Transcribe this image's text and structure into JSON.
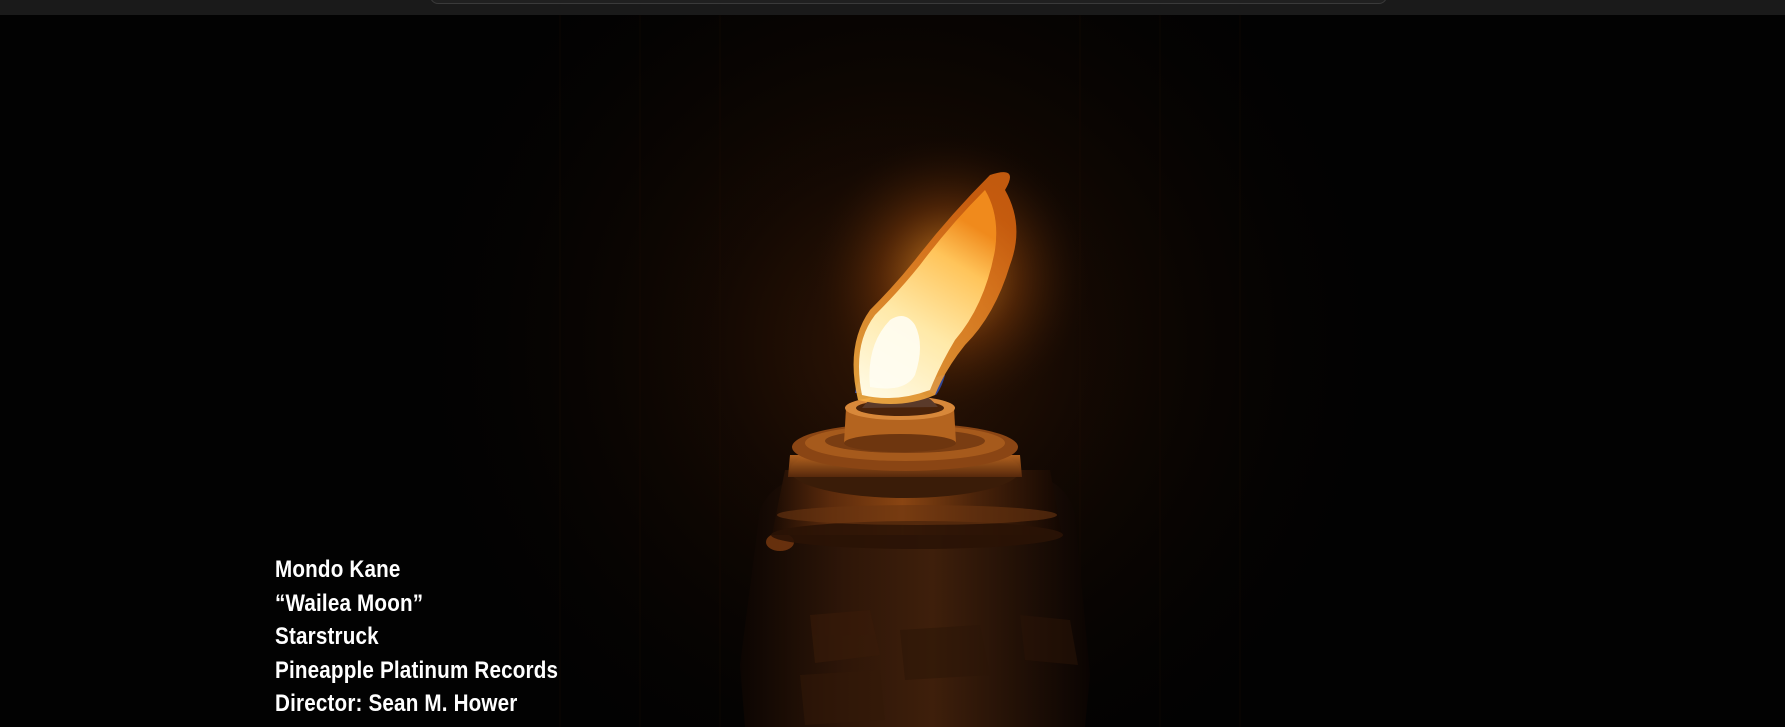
{
  "credits": {
    "artist": "Mondo Kane",
    "song": "“Wailea Moon”",
    "album": "Starstruck",
    "label": "Pineapple Platinum Records",
    "director": "Director: Sean M. Hower"
  },
  "colors": {
    "background": "#020202",
    "flame_core": "#fff3c4",
    "flame_outer": "#f7a531",
    "glow": "#8a3a08",
    "text": "#ffffff"
  }
}
